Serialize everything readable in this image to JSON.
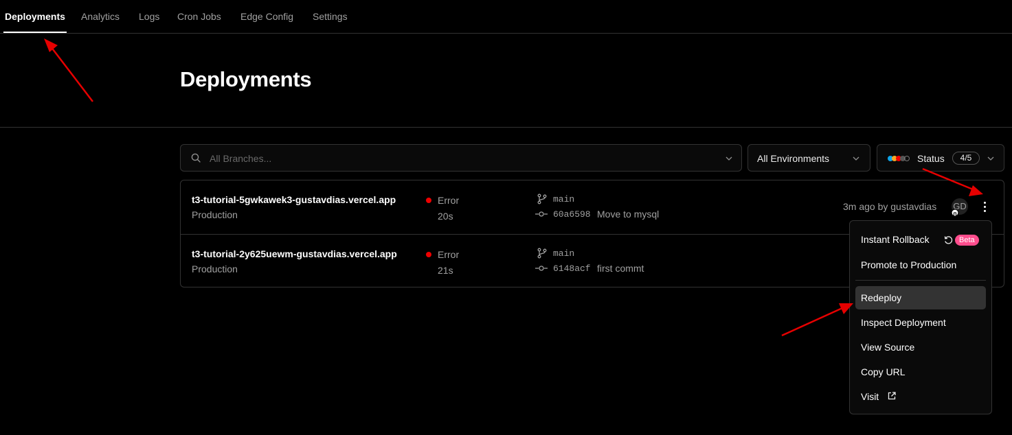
{
  "nav": {
    "tabs": [
      "Deployments",
      "Analytics",
      "Logs",
      "Cron Jobs",
      "Edge Config",
      "Settings"
    ],
    "active": "Deployments"
  },
  "page_title": "Deployments",
  "filters": {
    "branches_placeholder": "All Branches...",
    "environment": "All Environments",
    "status_label": "Status",
    "status_count": "4/5"
  },
  "deployments": [
    {
      "url": "t3-tutorial-5gwkawek3-gustavdias.vercel.app",
      "environment": "Production",
      "status": "Error",
      "duration": "20s",
      "branch": "main",
      "commit_sha": "60a6598",
      "commit_message": "Move to mysql",
      "meta": "3m ago by gustavdias",
      "avatar": "GD"
    },
    {
      "url": "t3-tutorial-2y625uewm-gustavdias.vercel.app",
      "environment": "Production",
      "status": "Error",
      "duration": "21s",
      "branch": "main",
      "commit_sha": "6148acf",
      "commit_message": "first commt"
    }
  ],
  "menu": {
    "instant_rollback": "Instant Rollback",
    "beta": "Beta",
    "promote": "Promote to Production",
    "redeploy": "Redeploy",
    "inspect": "Inspect Deployment",
    "view_source": "View Source",
    "copy_url": "Copy URL",
    "visit": "Visit"
  },
  "colors": {
    "background": "#000000",
    "border": "#333333",
    "error": "#ee0000",
    "beta_badge": "#ff4d8d",
    "annotation_arrow": "#e60000"
  },
  "icons": [
    "search-icon",
    "chevron-down-icon",
    "status-dots-icon",
    "branch-icon",
    "commit-icon",
    "more-vertical-icon",
    "rollback-icon",
    "external-link-icon"
  ]
}
